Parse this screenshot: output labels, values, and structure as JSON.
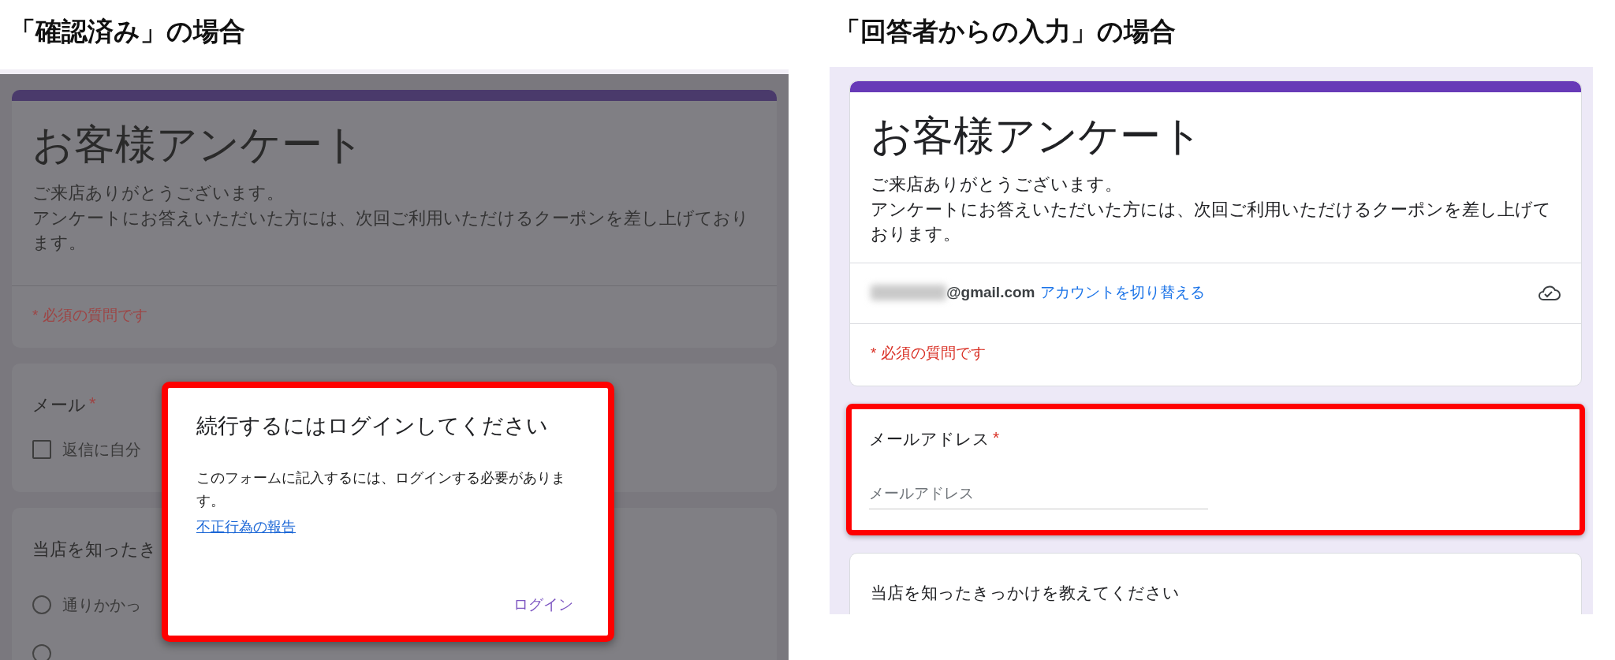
{
  "headings": [
    "「確認済み」の場合",
    "「回答者からの入力」の場合"
  ],
  "left": {
    "form_title": "お客様アンケート",
    "description": [
      "ご来店ありがとうございます。",
      "アンケートにお答えいただいた方には、次回ご利用いただけるクーポンを差し上げております。"
    ],
    "required_note": "* 必須の質問です",
    "email_question": {
      "label": "メール",
      "required_mark": "*",
      "checkbox": {
        "label": "返信に自分",
        "checked": false
      }
    },
    "question": {
      "label": "当店を知ったき",
      "options": [
        {
          "label": "通りかかっ",
          "selected": false
        },
        {
          "selected": false
        }
      ]
    },
    "dialog": {
      "title": "続行するにはログインしてください",
      "body": "このフォームに記入するには、ログインする必要があります。",
      "link": "不正行為の報告",
      "button": "ログイン"
    }
  },
  "right": {
    "form_title": "お客様アンケート",
    "description": [
      "ご来店ありがとうございます。",
      "アンケートにお答えいただいた方には、次回ご利用いただけるクーポンを差し上げております。"
    ],
    "account": {
      "email": "@gmail.com",
      "switch_link": "アカウントを切り替える"
    },
    "required_note": "* 必須の質問です",
    "email_question": {
      "label": "メールアドレス",
      "required_mark": "*",
      "placeholder": "メールアドレス"
    },
    "question": {
      "label": "当店を知ったきっかけを教えてください"
    }
  }
}
